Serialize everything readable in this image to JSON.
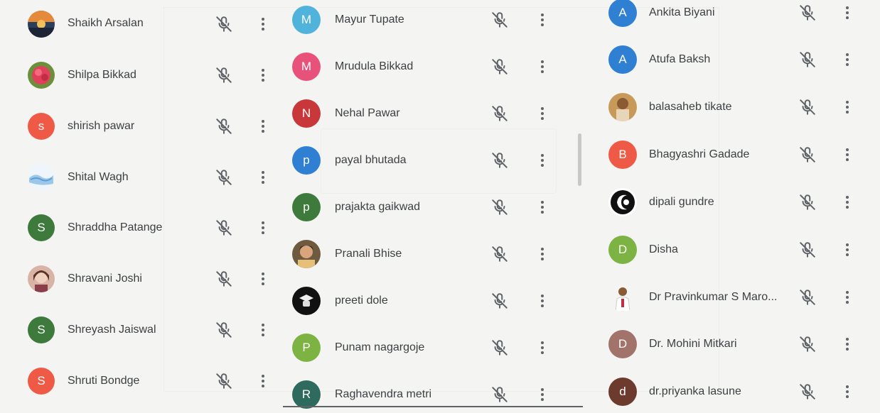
{
  "participants": {
    "col1": [
      {
        "name": "Shaikh Arsalan",
        "avatar": "photo"
      },
      {
        "name": "Shilpa Bikkad",
        "avatar": "photo"
      },
      {
        "name": "shirish pawar",
        "avatar": "s",
        "color": "#ef5a47"
      },
      {
        "name": "Shital Wagh",
        "avatar": "photo"
      },
      {
        "name": "Shraddha Patange",
        "avatar": "S",
        "color": "#3d7a3c"
      },
      {
        "name": "Shravani Joshi",
        "avatar": "photo"
      },
      {
        "name": "Shreyash Jaiswal",
        "avatar": "S",
        "color": "#3d7a3c"
      },
      {
        "name": "Shruti Bondge",
        "avatar": "S",
        "color": "#ef5a47"
      }
    ],
    "col2": [
      {
        "name": "Mayur Tupate",
        "avatar": "M",
        "color": "#4fb3dc"
      },
      {
        "name": "Mrudula Bikkad",
        "avatar": "M",
        "color": "#e8527a"
      },
      {
        "name": "Nehal Pawar",
        "avatar": "N",
        "color": "#c8383a"
      },
      {
        "name": "payal bhutada",
        "avatar": "p",
        "color": "#2f7fd3"
      },
      {
        "name": "prajakta gaikwad",
        "avatar": "p",
        "color": "#3d7a3c"
      },
      {
        "name": "Pranali Bhise",
        "avatar": "photo"
      },
      {
        "name": "preeti dole",
        "avatar": "photo"
      },
      {
        "name": "Punam nagargoje",
        "avatar": "P",
        "color": "#7cb342"
      },
      {
        "name": "Raghavendra metri",
        "avatar": "R",
        "color": "#2e6b5e"
      }
    ],
    "col3": [
      {
        "name": "Ankita Biyani",
        "avatar": "A",
        "color": "#2f7fd3"
      },
      {
        "name": "Atufa Baksh",
        "avatar": "A",
        "color": "#2f7fd3"
      },
      {
        "name": "balasaheb tikate",
        "avatar": "photo"
      },
      {
        "name": "Bhagyashri Gadade",
        "avatar": "B",
        "color": "#ef5a47"
      },
      {
        "name": "dipali gundre",
        "avatar": "photo"
      },
      {
        "name": "Disha",
        "avatar": "D",
        "color": "#7cb342"
      },
      {
        "name": "Dr Pravinkumar S Maro...",
        "avatar": "photo"
      },
      {
        "name": "Dr. Mohini Mitkari",
        "avatar": "D",
        "color": "#a1736a"
      },
      {
        "name": "dr.priyanka lasune",
        "avatar": "d",
        "color": "#6d3b2e"
      }
    ]
  },
  "icons": {
    "mute": "mic-off-icon",
    "more": "more-vert-icon"
  }
}
